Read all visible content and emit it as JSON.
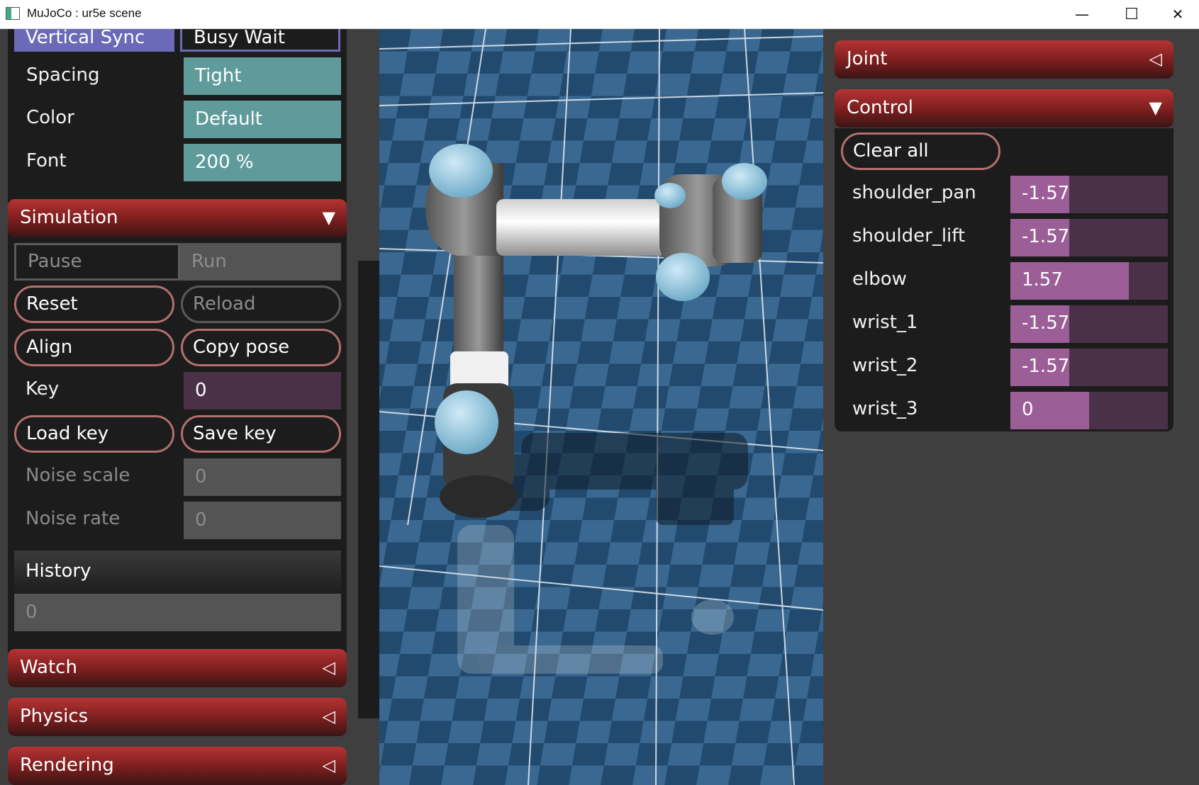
{
  "window": {
    "title": "MuJoCo : ur5e scene",
    "minimize": "—",
    "maximize": "☐",
    "close": "✕"
  },
  "ui_settings": {
    "vertical_sync_label": "Vertical Sync",
    "vertical_sync_value": "Busy Wait",
    "spacing_label": "Spacing",
    "spacing_value": "Tight",
    "color_label": "Color",
    "color_value": "Default",
    "font_label": "Font",
    "font_value": "200 %"
  },
  "simulation": {
    "header": "Simulation",
    "pause": "Pause",
    "run": "Run",
    "reset": "Reset",
    "reload": "Reload",
    "align": "Align",
    "copy_pose": "Copy pose",
    "key_label": "Key",
    "key_value": "0",
    "load_key": "Load key",
    "save_key": "Save key",
    "noise_scale_label": "Noise scale",
    "noise_scale_value": "0",
    "noise_rate_label": "Noise rate",
    "noise_rate_value": "0",
    "history_label": "History",
    "history_value": "0"
  },
  "collapsed_sections": {
    "watch": "Watch",
    "physics": "Physics",
    "rendering": "Rendering"
  },
  "right_panel": {
    "joint_header": "Joint",
    "control_header": "Control",
    "clear_all": "Clear all",
    "joints": [
      {
        "name": "shoulder_pan",
        "value": "-1.57",
        "fill": 0.375
      },
      {
        "name": "shoulder_lift",
        "value": "-1.57",
        "fill": 0.375
      },
      {
        "name": "elbow",
        "value": "1.57",
        "fill": 0.75
      },
      {
        "name": "wrist_1",
        "value": "-1.57",
        "fill": 0.375
      },
      {
        "name": "wrist_2",
        "value": "-1.57",
        "fill": 0.375
      },
      {
        "name": "wrist_3",
        "value": "0",
        "fill": 0.5
      }
    ]
  },
  "colors": {
    "header_red": "#b63333",
    "teal": "#5f9b9b",
    "slider_fill": "#9c5e96",
    "slider_bg": "#4a3148",
    "floor_blue": "#2b4f70"
  }
}
